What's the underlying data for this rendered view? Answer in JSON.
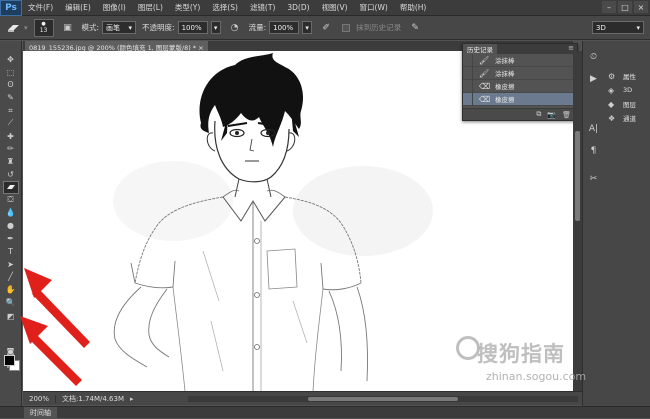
{
  "app": {
    "logo": "Ps",
    "menu": [
      "文件(F)",
      "编辑(E)",
      "图像(I)",
      "图层(L)",
      "类型(Y)",
      "选择(S)",
      "滤镜(T)",
      "3D(D)",
      "视图(V)",
      "窗口(W)",
      "帮助(H)"
    ],
    "window_controls": [
      "–",
      "□",
      "×"
    ]
  },
  "options": {
    "brush_size": "13",
    "mode_label": "模式:",
    "mode_value": "画笔",
    "opacity_label": "不透明度:",
    "opacity_value": "100%",
    "flow_label": "流量:",
    "flow_value": "100%",
    "erase_history_label": "抹到历史记录",
    "workspace": "3D"
  },
  "document": {
    "tab_title": "0819_155236.jpg @ 200% (颜色填充 1, 图层蒙版/8) * ×",
    "zoom": "200%",
    "doc_size": "文档:1.74M/4.63M"
  },
  "history": {
    "tab": "历史记录",
    "items": [
      {
        "icon": "brush-icon",
        "label": "涂抹棒",
        "active": false
      },
      {
        "icon": "brush-icon",
        "label": "涂抹棒",
        "active": false
      },
      {
        "icon": "eraser-icon",
        "label": "橡皮擦",
        "active": false
      },
      {
        "icon": "eraser-icon",
        "label": "橡皮擦",
        "active": true
      }
    ]
  },
  "dock": {
    "panels": [
      {
        "icon": "properties-icon",
        "label": "属性"
      },
      {
        "icon": "3d-icon",
        "label": "3D"
      },
      {
        "icon": "layers-icon",
        "label": "图层"
      },
      {
        "icon": "channels-icon",
        "label": "通道"
      }
    ]
  },
  "timeline": {
    "tab": "时间轴"
  },
  "watermark": {
    "text": "搜狗指南",
    "url": "zhinan.sogou.com"
  },
  "colors": {
    "accent": "#6b7a8f",
    "arrow": "#e0211b"
  }
}
